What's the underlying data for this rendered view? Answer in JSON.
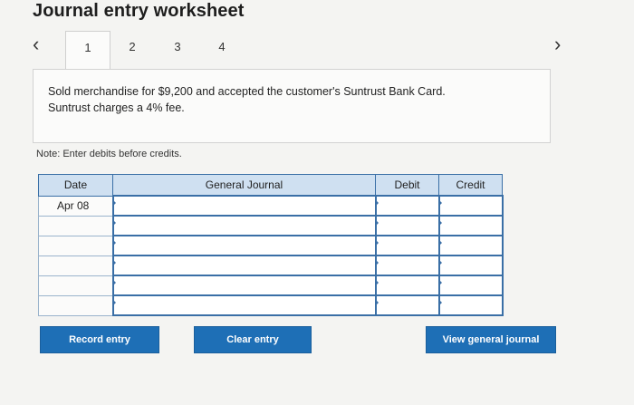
{
  "page": {
    "title": "Journal entry worksheet"
  },
  "tabs": {
    "prev_icon": "chevron-left-icon",
    "next_icon": "chevron-right-icon",
    "items": [
      {
        "label": "1",
        "active": true
      },
      {
        "label": "2",
        "active": false
      },
      {
        "label": "3",
        "active": false
      },
      {
        "label": "4",
        "active": false
      }
    ]
  },
  "transaction": {
    "line1": "Sold merchandise for $9,200 and accepted the customer's Suntrust Bank Card.",
    "line2": "Suntrust charges a 4% fee."
  },
  "note": "Note: Enter debits before credits.",
  "journal": {
    "headers": {
      "date": "Date",
      "account": "General Journal",
      "debit": "Debit",
      "credit": "Credit"
    },
    "rows": [
      {
        "date": "Apr 08",
        "account": "",
        "debit": "",
        "credit": ""
      },
      {
        "date": "",
        "account": "",
        "debit": "",
        "credit": ""
      },
      {
        "date": "",
        "account": "",
        "debit": "",
        "credit": ""
      },
      {
        "date": "",
        "account": "",
        "debit": "",
        "credit": ""
      },
      {
        "date": "",
        "account": "",
        "debit": "",
        "credit": ""
      },
      {
        "date": "",
        "account": "",
        "debit": "",
        "credit": ""
      }
    ]
  },
  "buttons": {
    "record": "Record entry",
    "clear": "Clear entry",
    "view": "View general journal"
  },
  "colors": {
    "button_blue": "#1e6fb6",
    "header_blue": "#cfe0f1",
    "border_blue": "#3a6fa6"
  }
}
